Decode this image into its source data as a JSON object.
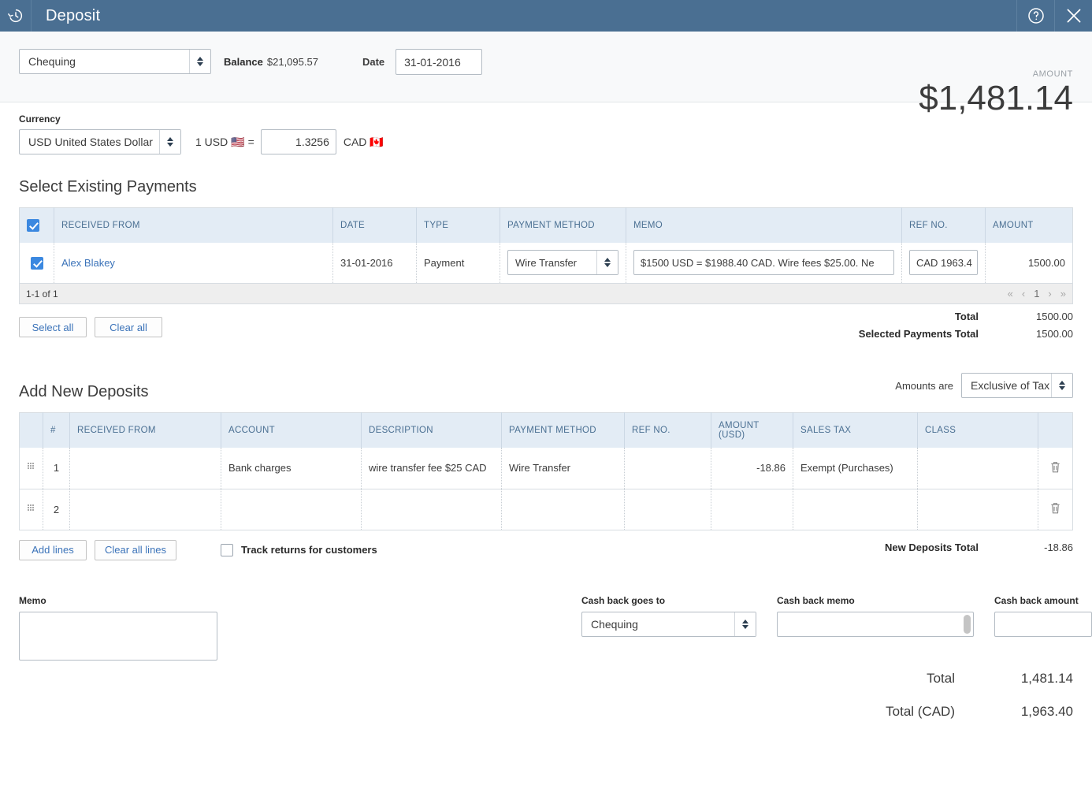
{
  "titlebar": {
    "app_icon": "history-clock-icon",
    "title": "Deposit",
    "help_label": "?",
    "close_label": "✕"
  },
  "header": {
    "account": "Chequing",
    "balance_label": "Balance",
    "balance_value": "$21,095.57",
    "date_label": "Date",
    "date_value": "31-01-2016",
    "amount_label": "AMOUNT",
    "amount_value": "$1,481.14"
  },
  "currency": {
    "label": "Currency",
    "selected": "USD United States Dollar",
    "rate_prefix": "1 USD",
    "from_flag": "🇺🇸",
    "equals": "=",
    "rate_value": "1.3256",
    "rate_suffix": "CAD",
    "to_flag": "🇨🇦"
  },
  "existing_payments": {
    "title": "Select Existing Payments",
    "headers": [
      "",
      "RECEIVED FROM",
      "DATE",
      "TYPE",
      "PAYMENT METHOD",
      "MEMO",
      "REF NO.",
      "AMOUNT"
    ],
    "header_checkbox_checked": true,
    "rows": [
      {
        "checked": true,
        "received_from": "Alex Blakey",
        "date": "31-01-2016",
        "type": "Payment",
        "payment_method": "Wire Transfer",
        "memo": "$1500 USD = $1988.40 CAD. Wire fees $25.00. Ne",
        "ref_no": "CAD 1963.4",
        "amount": "1500.00"
      }
    ],
    "pager_text": "1-1 of 1",
    "pager": {
      "first": "«",
      "prev": "‹",
      "current": "1",
      "next": "›",
      "last": "»"
    },
    "select_all_label": "Select all",
    "clear_all_label": "Clear all",
    "total_label": "Total",
    "total_value": "1500.00",
    "selected_total_label": "Selected Payments Total",
    "selected_total_value": "1500.00"
  },
  "new_deposits": {
    "title": "Add New Deposits",
    "amounts_are_label": "Amounts are",
    "amounts_are_value": "Exclusive of Tax",
    "headers": [
      "",
      "#",
      "RECEIVED FROM",
      "ACCOUNT",
      "DESCRIPTION",
      "PAYMENT METHOD",
      "REF NO.",
      "AMOUNT (USD)",
      "SALES TAX",
      "CLASS",
      ""
    ],
    "rows": [
      {
        "num": "1",
        "received_from": "",
        "account": "Bank charges",
        "description": "wire transfer fee $25 CAD",
        "payment_method": "Wire Transfer",
        "ref_no": "",
        "amount": "-18.86",
        "sales_tax": "Exempt (Purchases)",
        "class": ""
      },
      {
        "num": "2",
        "received_from": "",
        "account": "",
        "description": "",
        "payment_method": "",
        "ref_no": "",
        "amount": "",
        "sales_tax": "",
        "class": ""
      }
    ],
    "add_lines_label": "Add lines",
    "clear_all_lines_label": "Clear all lines",
    "track_returns_label": "Track returns for customers",
    "track_returns_checked": false,
    "new_deposits_total_label": "New Deposits Total",
    "new_deposits_total_value": "-18.86"
  },
  "footer": {
    "memo_label": "Memo",
    "memo_value": "",
    "cash_back_goes_to_label": "Cash back goes to",
    "cash_back_goes_to_value": "Chequing",
    "cash_back_memo_label": "Cash back memo",
    "cash_back_memo_value": "",
    "cash_back_amount_label": "Cash back amount",
    "cash_back_amount_value": "",
    "total_label": "Total",
    "total_value": "1,481.14",
    "total_cad_label": "Total (CAD)",
    "total_cad_value": "1,963.40"
  },
  "colors": {
    "titlebar": "#4a6f92",
    "header_bg": "#f8f9fa",
    "table_header_bg": "#e3ecf5",
    "accent_link": "#3b73b9",
    "checkbox_on": "#3b88e0"
  }
}
